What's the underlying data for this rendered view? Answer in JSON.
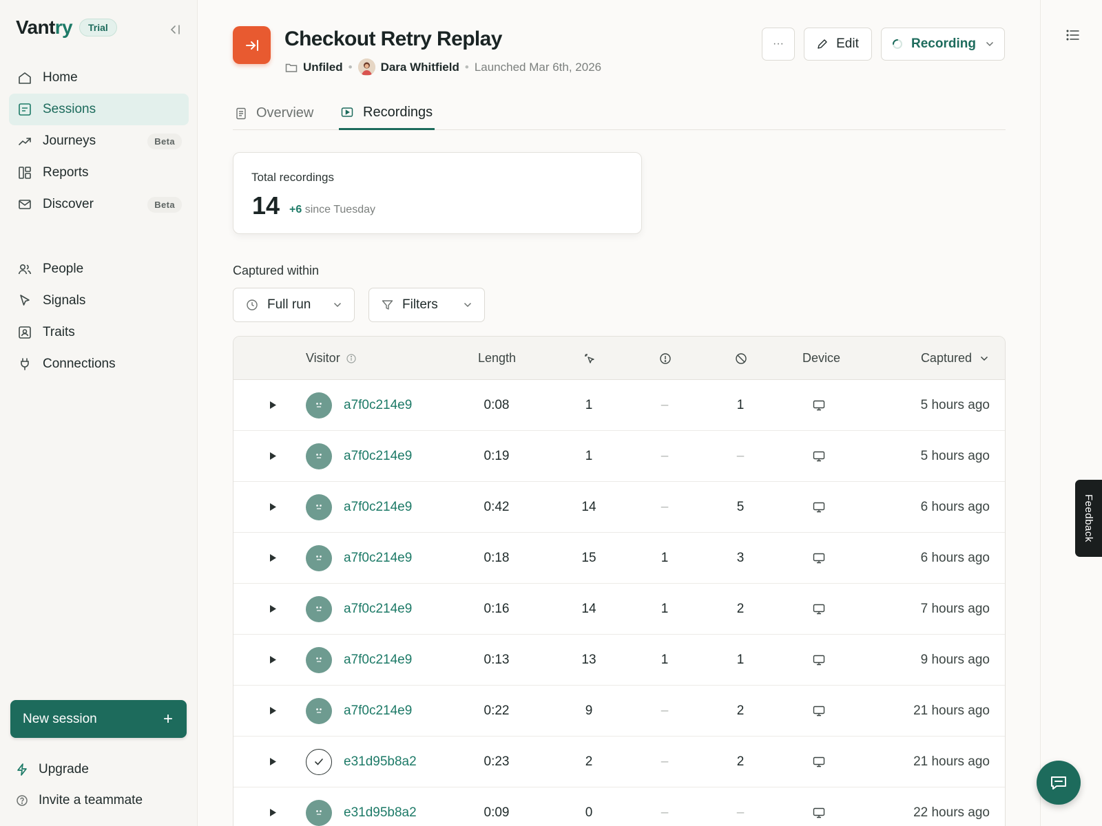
{
  "brand": {
    "name_prefix": "Vant",
    "name_accent": "ry",
    "badge": "Trial"
  },
  "sidebar": {
    "items": [
      {
        "label": "Home",
        "icon": "home-icon",
        "active": false
      },
      {
        "label": "Sessions",
        "icon": "sessions-icon",
        "active": true
      },
      {
        "label": "Journeys",
        "icon": "trend-icon",
        "badge": "Beta"
      },
      {
        "label": "Reports",
        "icon": "reports-icon"
      },
      {
        "label": "Discover",
        "icon": "mail-icon",
        "badge": "Beta"
      },
      {
        "label": "People",
        "icon": "people-icon"
      },
      {
        "label": "Signals",
        "icon": "cursor-icon"
      },
      {
        "label": "Traits",
        "icon": "id-card-icon"
      },
      {
        "label": "Connections",
        "icon": "plug-icon"
      }
    ],
    "new_session": "New session",
    "upgrade": "Upgrade",
    "invite": "Invite a teammate"
  },
  "header": {
    "title": "Checkout Retry Replay",
    "folder": "Unfiled",
    "owner": "Dara Whitfield",
    "launched": "Launched Mar 6th, 2026",
    "more_label": "···",
    "edit_label": "Edit",
    "status_label": "Recording"
  },
  "tabs": [
    {
      "label": "Overview",
      "active": false
    },
    {
      "label": "Recordings",
      "active": true
    }
  ],
  "stats": {
    "label": "Total recordings",
    "value": "14",
    "delta": "+6",
    "delta_suffix": "since Tuesday"
  },
  "filters": {
    "section_label": "Captured within",
    "range": "Full run",
    "filters": "Filters"
  },
  "table": {
    "headers": {
      "visitor": "Visitor",
      "length": "Length",
      "device": "Device",
      "captured": "Captured"
    },
    "rows": [
      {
        "visitor": "a7f0c214e9",
        "length": "0:08",
        "clicks": "1",
        "errors": "–",
        "blocked": "1",
        "captured": "5 hours ago",
        "avatar": "face"
      },
      {
        "visitor": "a7f0c214e9",
        "length": "0:19",
        "clicks": "1",
        "errors": "–",
        "blocked": "–",
        "captured": "5 hours ago",
        "avatar": "face"
      },
      {
        "visitor": "a7f0c214e9",
        "length": "0:42",
        "clicks": "14",
        "errors": "–",
        "blocked": "5",
        "captured": "6 hours ago",
        "avatar": "face"
      },
      {
        "visitor": "a7f0c214e9",
        "length": "0:18",
        "clicks": "15",
        "errors": "1",
        "blocked": "3",
        "captured": "6 hours ago",
        "avatar": "face"
      },
      {
        "visitor": "a7f0c214e9",
        "length": "0:16",
        "clicks": "14",
        "errors": "1",
        "blocked": "2",
        "captured": "7 hours ago",
        "avatar": "face"
      },
      {
        "visitor": "a7f0c214e9",
        "length": "0:13",
        "clicks": "13",
        "errors": "1",
        "blocked": "1",
        "captured": "9 hours ago",
        "avatar": "face"
      },
      {
        "visitor": "a7f0c214e9",
        "length": "0:22",
        "clicks": "9",
        "errors": "–",
        "blocked": "2",
        "captured": "21 hours ago",
        "avatar": "face"
      },
      {
        "visitor": "e31d95b8a2",
        "length": "0:23",
        "clicks": "2",
        "errors": "–",
        "blocked": "2",
        "captured": "21 hours ago",
        "avatar": "check"
      },
      {
        "visitor": "e31d95b8a2",
        "length": "0:09",
        "clicks": "0",
        "errors": "–",
        "blocked": "–",
        "captured": "22 hours ago",
        "avatar": "face"
      }
    ]
  },
  "feedback_label": "Feedback",
  "colors": {
    "accent": "#1d6b5c",
    "app_icon": "#e85a30"
  }
}
